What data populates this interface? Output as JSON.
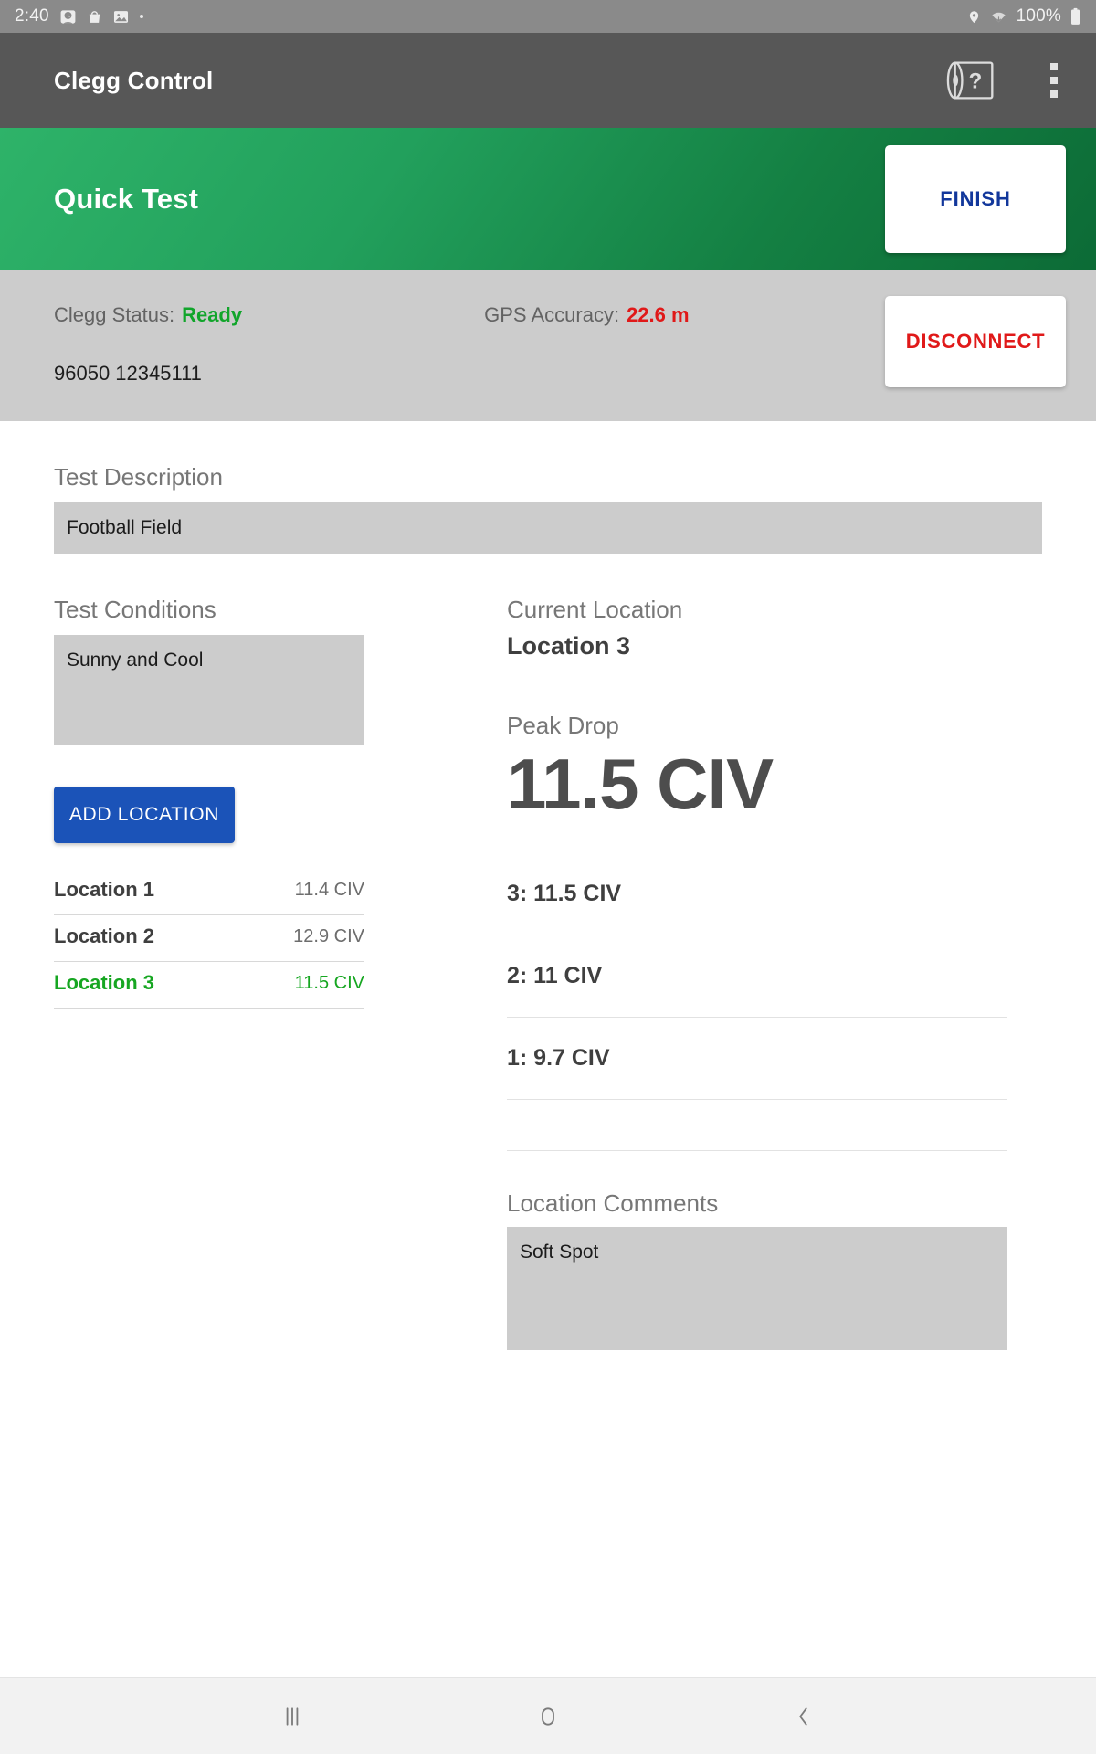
{
  "status_bar": {
    "time": "2:40",
    "battery_percent": "100%",
    "icons": [
      "alarm-icon",
      "bag-icon",
      "image-icon",
      "dot-icon",
      "location-pin-icon",
      "wifi-icon",
      "battery-icon"
    ]
  },
  "app_bar": {
    "title": "Clegg Control",
    "help_icon": "clegg-hammer-help-icon",
    "overflow_icon": "overflow-menu-icon"
  },
  "hero": {
    "title": "Quick Test",
    "finish_label": "FINISH",
    "finish_text_color": "#12379b",
    "gradient_from": "#2eb369",
    "gradient_to": "#0c6b36"
  },
  "status_strip": {
    "clegg_status_label": "Clegg Status:",
    "clegg_status_value": "Ready",
    "clegg_status_color": "#11a52b",
    "gps_label": "GPS Accuracy:",
    "gps_value": "22.6 m",
    "gps_color": "#e01919",
    "serial": "96050 12345111",
    "disconnect_label": "DISCONNECT",
    "disconnect_color": "#e01919"
  },
  "test_description": {
    "label": "Test Description",
    "value": "Football Field"
  },
  "test_conditions": {
    "label": "Test Conditions",
    "value": "Sunny and Cool"
  },
  "add_location_button": {
    "label": "ADD LOCATION",
    "color": "#1b53b8"
  },
  "locations": {
    "items": [
      {
        "name": "Location 1",
        "value": "11.4 CIV",
        "selected": false
      },
      {
        "name": "Location 2",
        "value": "12.9 CIV",
        "selected": false
      },
      {
        "name": "Location 3",
        "value": "11.5 CIV",
        "selected": true
      }
    ],
    "selected_color": "#16a621"
  },
  "current_location": {
    "label": "Current Location",
    "value": "Location 3"
  },
  "peak_drop": {
    "label": "Peak Drop",
    "value": "11.5 CIV"
  },
  "drops": {
    "items": [
      {
        "text": "3: 11.5 CIV"
      },
      {
        "text": "2: 11 CIV"
      },
      {
        "text": "1: 9.7 CIV"
      },
      {
        "text": ""
      }
    ]
  },
  "location_comments": {
    "label": "Location Comments",
    "value": "Soft Spot"
  },
  "nav_bar": {
    "recents_icon": "recents-icon",
    "home_icon": "home-icon",
    "back_icon": "back-icon"
  }
}
